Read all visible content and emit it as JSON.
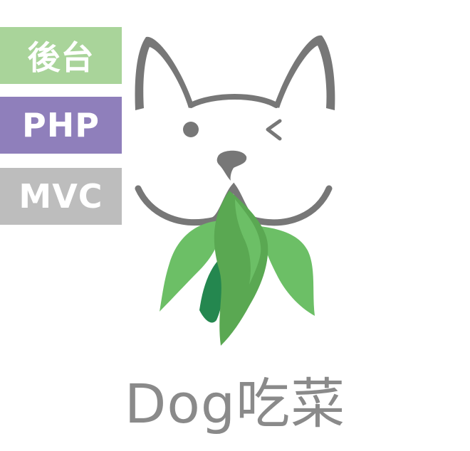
{
  "tags": {
    "backend": "後台",
    "php": "PHP",
    "mvc": "MVC"
  },
  "brand": {
    "name": "Dog吃菜"
  },
  "colors": {
    "backend_tag": "#a9d49a",
    "php_tag": "#8f7fbb",
    "mvc_tag": "#bdbdbd",
    "dog_outline": "#777777",
    "leaf_light": "#6cbf66",
    "leaf_mid": "#5aa852",
    "leaf_dark": "#24874f",
    "brand_text": "#8a8a8a"
  },
  "icons": {
    "logo": "dog-eating-vegetables-logo"
  }
}
